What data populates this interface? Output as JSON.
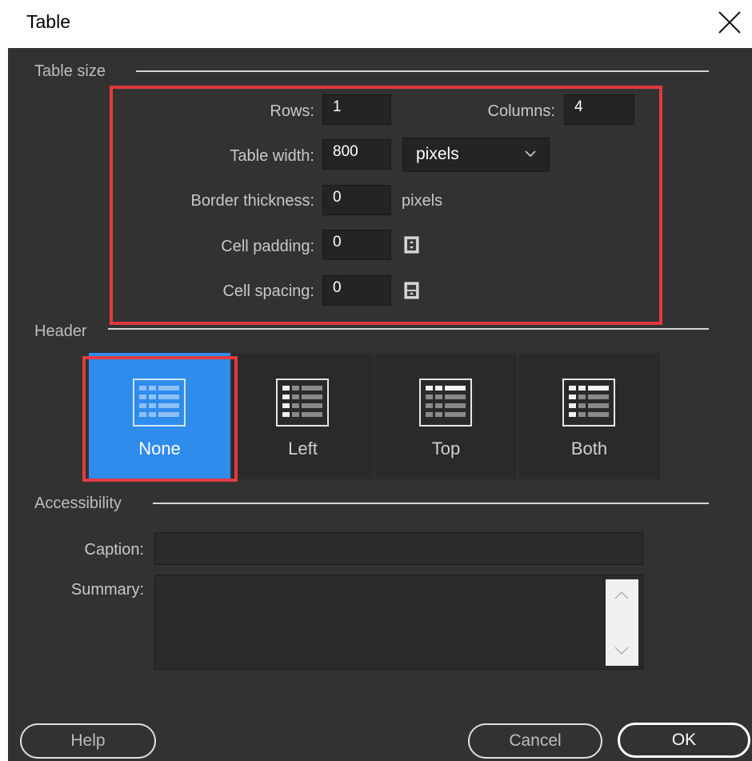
{
  "window": {
    "title": "Table"
  },
  "table_size": {
    "section_label": "Table size",
    "rows_label": "Rows:",
    "rows_value": "1",
    "columns_label": "Columns:",
    "columns_value": "4",
    "width_label": "Table width:",
    "width_value": "800",
    "width_unit_selected": "pixels",
    "border_label": "Border thickness:",
    "border_value": "0",
    "border_unit": "pixels",
    "padding_label": "Cell padding:",
    "padding_value": "0",
    "spacing_label": "Cell spacing:",
    "spacing_value": "0"
  },
  "header": {
    "section_label": "Header",
    "options": [
      {
        "label": "None",
        "selected": true
      },
      {
        "label": "Left",
        "selected": false
      },
      {
        "label": "Top",
        "selected": false
      },
      {
        "label": "Both",
        "selected": false
      }
    ]
  },
  "accessibility": {
    "section_label": "Accessibility",
    "caption_label": "Caption:",
    "caption_value": "",
    "summary_label": "Summary:",
    "summary_value": ""
  },
  "buttons": {
    "help": "Help",
    "cancel": "Cancel",
    "ok": "OK"
  },
  "colors": {
    "dialog_bg": "#323232",
    "field_bg": "#242424",
    "selected": "#2f8cec",
    "highlight": "#e23a3f"
  }
}
